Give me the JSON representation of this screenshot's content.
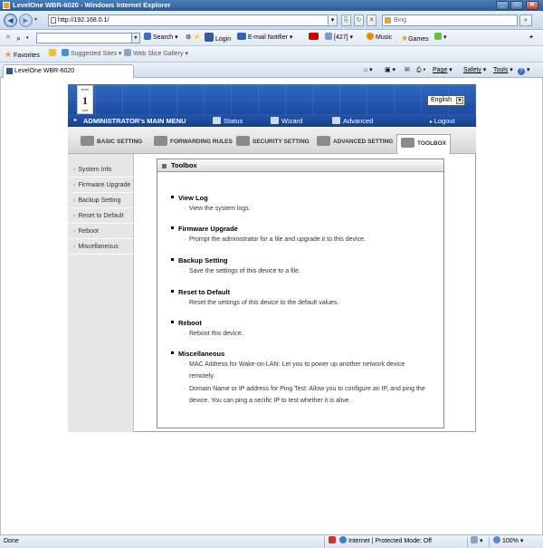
{
  "window": {
    "title": "LevelOne WBR-6020 - Windows Internet Explorer",
    "min": "_",
    "max": "□",
    "close": "✕"
  },
  "navbar": {
    "address": "http://192.168.0.1/",
    "search_placeholder": "Bing"
  },
  "toolbar": {
    "search_label": "Search",
    "login_label": "Login",
    "email_label": "E-mail Notifier",
    "count_label": "[427]",
    "music_label": "Music",
    "games_label": "Games"
  },
  "favorites": {
    "favorites_label": "Favorites",
    "suggested_label": "Suggested Sites",
    "webslice_label": "Web Slice Gallery"
  },
  "tab": {
    "title": "LevelOne WBR-6020"
  },
  "commandbar": {
    "page": "Page",
    "safety": "Safety",
    "tools": "Tools",
    "help_glyph": "?"
  },
  "router": {
    "logo_top": "level",
    "logo_glyph": "1",
    "logo_bottom": "one",
    "language": "English",
    "main_menu_title": "ADMINISTRATOR's MAIN MENU",
    "menu": {
      "status": "Status",
      "wizard": "Wizard",
      "advanced": "Advanced",
      "logout": "Logout"
    },
    "tabs": [
      {
        "label": "BASIC SETTING"
      },
      {
        "label": "FORWARDING RULES"
      },
      {
        "label": "SECURITY SETTING"
      },
      {
        "label": "ADVANCED SETTING"
      },
      {
        "label": "TOOLBOX"
      }
    ],
    "left_nav": [
      {
        "label": "System Info"
      },
      {
        "label": "Firmware Upgrade"
      },
      {
        "label": "Backup Setting"
      },
      {
        "label": "Reset to Default"
      },
      {
        "label": "Reboot"
      },
      {
        "label": "Miscellaneous"
      }
    ],
    "content_title": "Toolbox",
    "sections": [
      {
        "title": "View Log",
        "descs": [
          "View the system logs."
        ]
      },
      {
        "title": "Firmware Upgrade",
        "descs": [
          "Prompt the administrator for a file and upgrade it to this device."
        ]
      },
      {
        "title": "Backup Setting",
        "descs": [
          "Save the settings of this device to a file."
        ]
      },
      {
        "title": "Reset to Default",
        "descs": [
          "Reset the settings of this device to the default values."
        ]
      },
      {
        "title": "Reboot",
        "descs": [
          "Reboot this device."
        ]
      },
      {
        "title": "Miscellaneous",
        "descs": [
          "MAC Address for Wake-on-LAN: Let you to power up another network device remotely.",
          "Domain Name or IP address for Ping Test: Allow you to configure an IP, and ping the device. You can ping a secific IP to test whether it is alive."
        ]
      }
    ]
  },
  "status": {
    "left": "Done",
    "zone": "Internet | Protected Mode: Off",
    "zoom": "100%"
  }
}
